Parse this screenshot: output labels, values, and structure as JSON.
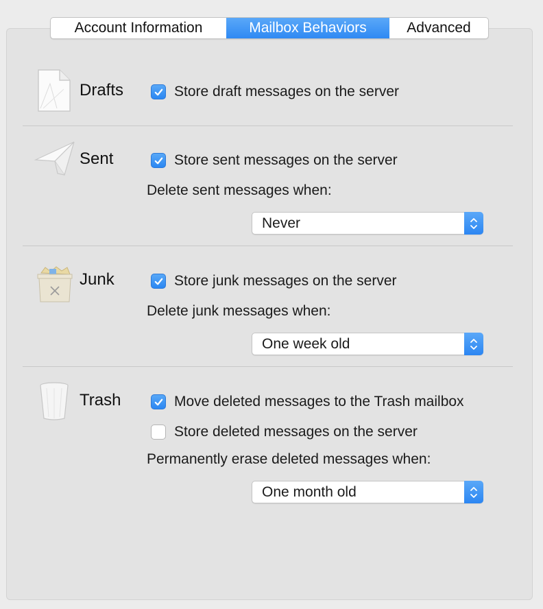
{
  "tabs": [
    {
      "label": "Account Information",
      "active": false
    },
    {
      "label": "Mailbox Behaviors",
      "active": true
    },
    {
      "label": "Advanced",
      "active": false
    }
  ],
  "drafts": {
    "title": "Drafts",
    "icon": "drafts-document-icon",
    "store_checkbox": {
      "label": "Store draft messages on the server",
      "checked": true
    }
  },
  "sent": {
    "title": "Sent",
    "icon": "paper-plane-icon",
    "store_checkbox": {
      "label": "Store sent messages on the server",
      "checked": true
    },
    "delete_label": "Delete sent messages when:",
    "delete_value": "Never"
  },
  "junk": {
    "title": "Junk",
    "icon": "junk-bin-icon",
    "store_checkbox": {
      "label": "Store junk messages on the server",
      "checked": true
    },
    "delete_label": "Delete junk messages when:",
    "delete_value": "One week old"
  },
  "trash": {
    "title": "Trash",
    "icon": "trash-can-icon",
    "move_checkbox": {
      "label": "Move deleted messages to the Trash mailbox",
      "checked": true
    },
    "store_checkbox": {
      "label": "Store deleted messages on the server",
      "checked": false
    },
    "erase_label": "Permanently erase deleted messages when:",
    "erase_value": "One month old"
  },
  "colors": {
    "accent": "#2f89f3",
    "panel": "#e3e3e3",
    "window": "#ececec"
  }
}
